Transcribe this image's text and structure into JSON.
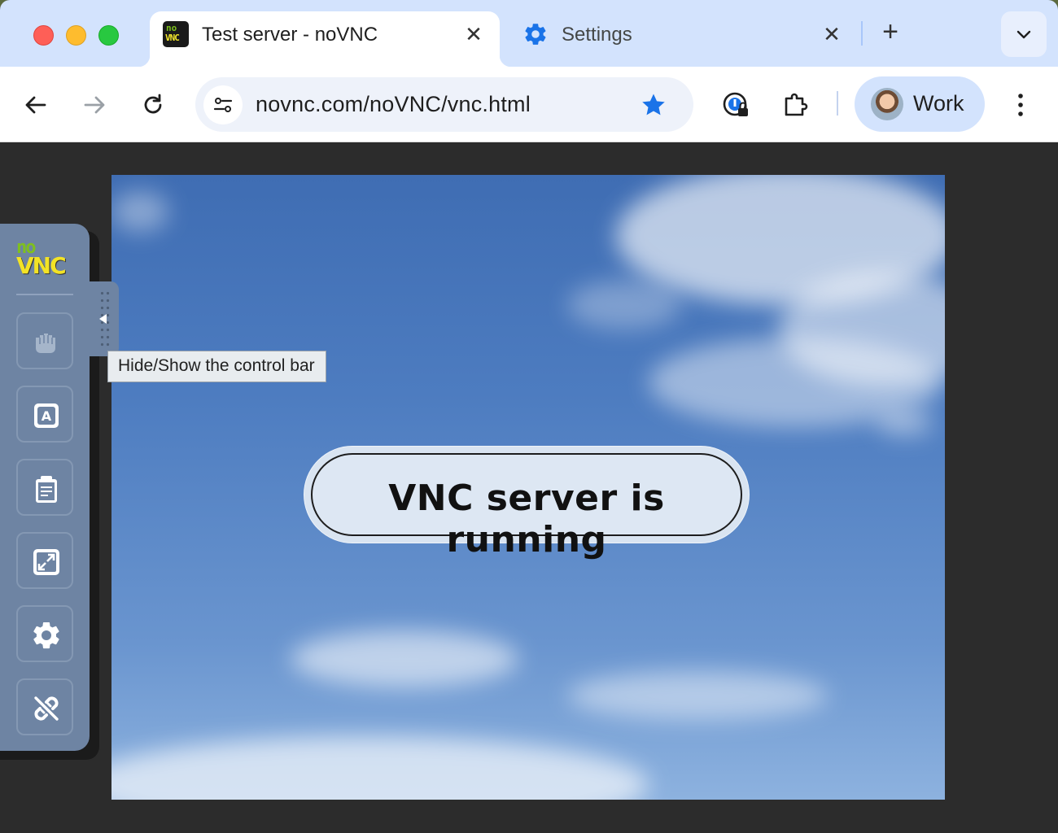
{
  "window": {
    "traffic_lights": {
      "close": "#fe5f57",
      "minimize": "#febc2e",
      "maximize": "#28c840"
    }
  },
  "tabs": [
    {
      "title": "Test server - noVNC",
      "active": true,
      "favicon": "novnc-favicon",
      "favicon_text": [
        "no",
        "VNC"
      ]
    },
    {
      "title": "Settings",
      "active": false,
      "favicon": "settings-gear-icon"
    }
  ],
  "toolbar": {
    "url": "novnc.com/noVNC/vnc.html",
    "bookmarked": true,
    "profile_name": "Work"
  },
  "novnc": {
    "logo": {
      "line1": "no",
      "line2": "VNC"
    },
    "tooltip": "Hide/Show the control bar",
    "buttons": [
      "drag-viewport-icon",
      "keyboard-icon",
      "clipboard-icon",
      "fullscreen-icon",
      "settings-icon",
      "disconnect-icon"
    ]
  },
  "remote_screen": {
    "message": "VNC server is running"
  },
  "colors": {
    "tabstrip": "#d3e3fd",
    "controlbar": "#6e84a3",
    "accent_blue": "#1a73e8"
  }
}
